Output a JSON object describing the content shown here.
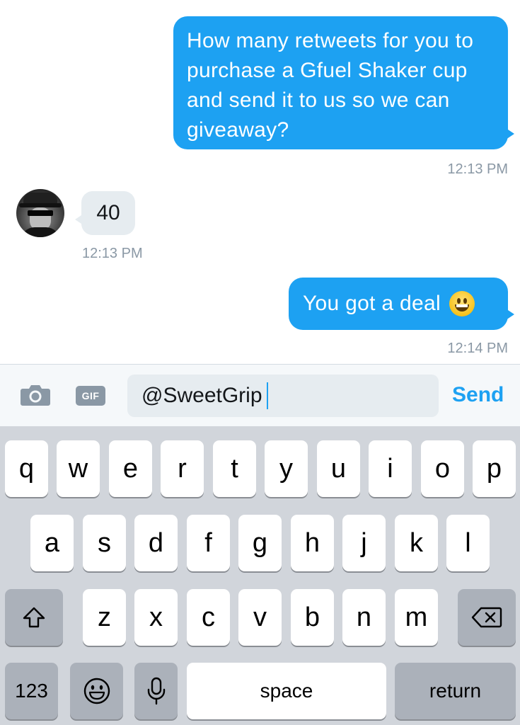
{
  "conversation": {
    "messages": [
      {
        "from": "me",
        "text": "How many retweets for you to purchase a Gfuel Shaker cup and send it to us so we can giveaway?",
        "time": "12:13 PM"
      },
      {
        "from": "them",
        "text": "40",
        "time": "12:13 PM"
      },
      {
        "from": "me",
        "text": "You got a deal",
        "emoji": "grinning-face",
        "time": "12:14 PM"
      }
    ]
  },
  "composer": {
    "gif_label": "GIF",
    "input_value": "@SweetGrip",
    "send_label": "Send"
  },
  "keyboard": {
    "row1": [
      "q",
      "w",
      "e",
      "r",
      "t",
      "y",
      "u",
      "i",
      "o",
      "p"
    ],
    "row2": [
      "a",
      "s",
      "d",
      "f",
      "g",
      "h",
      "j",
      "k",
      "l"
    ],
    "row3": [
      "z",
      "x",
      "c",
      "v",
      "b",
      "n",
      "m"
    ],
    "numbers_label": "123",
    "space_label": "space",
    "return_label": "return"
  },
  "colors": {
    "accent": "#1da1f2",
    "bubble_in": "#e6ecf0",
    "keyboard_bg": "#d1d5db"
  }
}
